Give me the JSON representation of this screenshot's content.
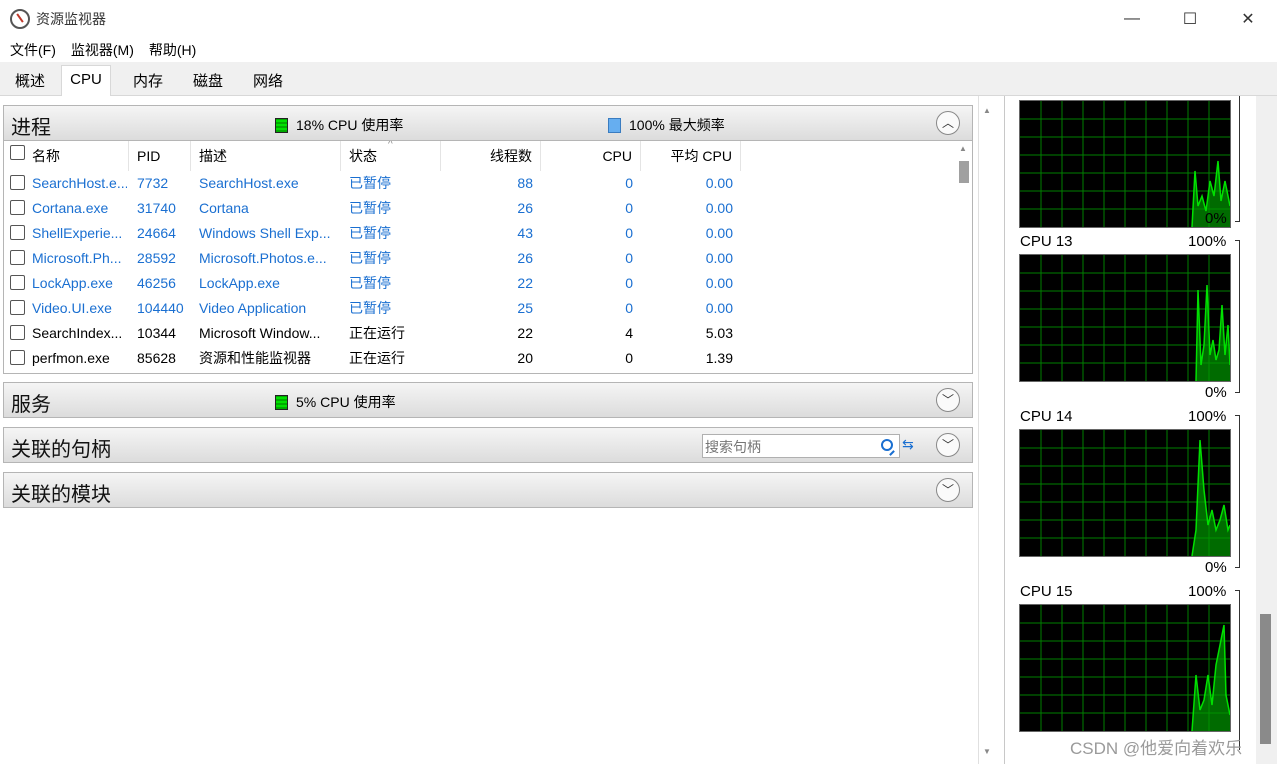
{
  "window": {
    "title": "资源监视器",
    "controls": [
      "—",
      "☐",
      "✕"
    ]
  },
  "menu": [
    "文件(F)",
    "监视器(M)",
    "帮助(H)"
  ],
  "tabs": [
    "概述",
    "CPU",
    "内存",
    "磁盘",
    "网络"
  ],
  "processes": {
    "title": "进程",
    "cpu_legend": "18% CPU 使用率",
    "freq_legend": "100% 最大频率",
    "columns": [
      "名称",
      "PID",
      "描述",
      "状态",
      "线程数",
      "CPU",
      "平均 CPU"
    ],
    "rows": [
      {
        "name": "SearchHost.e...",
        "pid": "7732",
        "desc": "SearchHost.exe",
        "status": "已暂停",
        "threads": "88",
        "cpu": "0",
        "avg": "0.00",
        "paused": true
      },
      {
        "name": "Cortana.exe",
        "pid": "31740",
        "desc": "Cortana",
        "status": "已暂停",
        "threads": "26",
        "cpu": "0",
        "avg": "0.00",
        "paused": true
      },
      {
        "name": "ShellExperie...",
        "pid": "24664",
        "desc": "Windows Shell Exp...",
        "status": "已暂停",
        "threads": "43",
        "cpu": "0",
        "avg": "0.00",
        "paused": true
      },
      {
        "name": "Microsoft.Ph...",
        "pid": "28592",
        "desc": "Microsoft.Photos.e...",
        "status": "已暂停",
        "threads": "26",
        "cpu": "0",
        "avg": "0.00",
        "paused": true
      },
      {
        "name": "LockApp.exe",
        "pid": "46256",
        "desc": "LockApp.exe",
        "status": "已暂停",
        "threads": "22",
        "cpu": "0",
        "avg": "0.00",
        "paused": true
      },
      {
        "name": "Video.UI.exe",
        "pid": "104440",
        "desc": "Video Application",
        "status": "已暂停",
        "threads": "25",
        "cpu": "0",
        "avg": "0.00",
        "paused": true
      },
      {
        "name": "SearchIndex...",
        "pid": "10344",
        "desc": "Microsoft Window...",
        "status": "正在运行",
        "threads": "22",
        "cpu": "4",
        "avg": "5.03",
        "paused": false
      },
      {
        "name": "perfmon.exe",
        "pid": "85628",
        "desc": "资源和性能监视器",
        "status": "正在运行",
        "threads": "20",
        "cpu": "0",
        "avg": "1.39",
        "paused": false
      }
    ]
  },
  "services": {
    "title": "服务",
    "cpu_legend": "5% CPU 使用率"
  },
  "handles": {
    "title": "关联的句柄",
    "search_placeholder": "搜索句柄"
  },
  "modules": {
    "title": "关联的模块"
  },
  "cpu_graphs": [
    {
      "min_label": "0%"
    },
    {
      "label": "CPU 13",
      "max_label": "100%",
      "min_label": "0%"
    },
    {
      "label": "CPU 14",
      "max_label": "100%",
      "min_label": "0%"
    },
    {
      "label": "CPU 15",
      "max_label": "100%"
    }
  ],
  "watermark": "CSDN @他爱向着欢乐",
  "colors": {
    "graph_line": "#00d000",
    "graph_grid": "#008000",
    "paused_text": "#1a6fd1"
  }
}
